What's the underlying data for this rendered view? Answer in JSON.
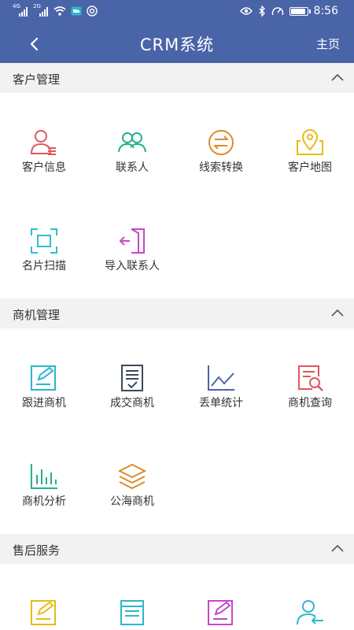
{
  "status_bar": {
    "sim1": "4G",
    "sim2": "2G",
    "time": "8:56",
    "battery_level": 0.85
  },
  "nav": {
    "title": "CRM系统",
    "home": "主页",
    "back_icon": "chevron-left-icon"
  },
  "sections": [
    {
      "title": "客户管理",
      "items": [
        {
          "label": "客户信息",
          "icon": "user-list-icon",
          "color": "#e0575d"
        },
        {
          "label": "联系人",
          "icon": "contacts-icon",
          "color": "#25b08f"
        },
        {
          "label": "线索转换",
          "icon": "exchange-icon",
          "color": "#dd8b2a"
        },
        {
          "label": "客户地图",
          "icon": "map-pin-icon",
          "color": "#e8bb17"
        },
        {
          "label": "名片扫描",
          "icon": "scan-icon",
          "color": "#2dbfd2"
        },
        {
          "label": "导入联系人",
          "icon": "import-icon",
          "color": "#c547c9"
        }
      ]
    },
    {
      "title": "商机管理",
      "items": [
        {
          "label": "跟进商机",
          "icon": "edit-card-icon",
          "color": "#2bb6d0"
        },
        {
          "label": "成交商机",
          "icon": "checked-doc-icon",
          "color": "#3d4958"
        },
        {
          "label": "丢单统计",
          "icon": "line-chart-icon",
          "color": "#4a64a8"
        },
        {
          "label": "商机查询",
          "icon": "search-doc-icon",
          "color": "#e0575d"
        },
        {
          "label": "商机分析",
          "icon": "bar-chart-icon",
          "color": "#25b08f"
        },
        {
          "label": "公海商机",
          "icon": "layers-icon",
          "color": "#dd8b2a"
        }
      ]
    },
    {
      "title": "售后服务",
      "items": [
        {
          "label": "",
          "icon": "edit-card-icon",
          "color": "#e8bb17"
        },
        {
          "label": "",
          "icon": "doc-icon",
          "color": "#2bb6d0"
        },
        {
          "label": "",
          "icon": "edit-card-icon",
          "color": "#c547c9"
        },
        {
          "label": "",
          "icon": "user-return-icon",
          "color": "#2bb6d0"
        }
      ]
    }
  ]
}
